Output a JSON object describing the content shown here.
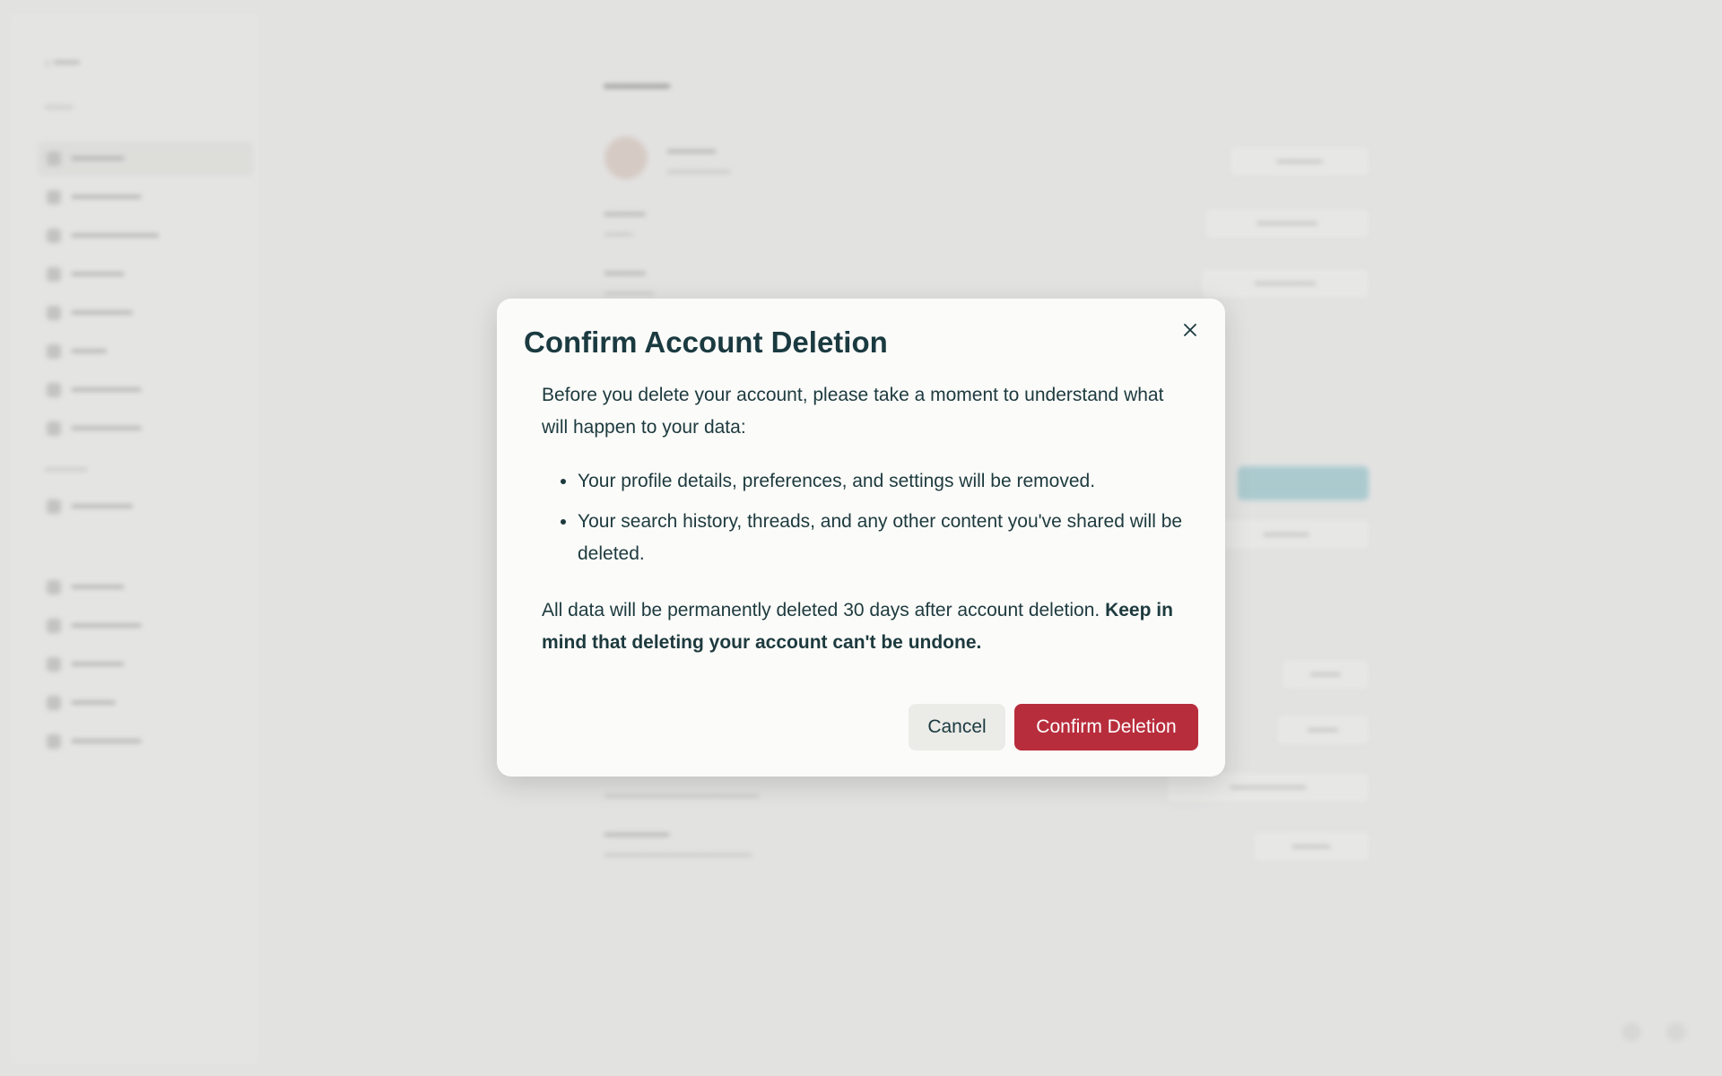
{
  "modal": {
    "title": "Confirm Account Deletion",
    "intro": "Before you delete your account, please take a moment to understand what will happen to your data:",
    "bullets": [
      "Your profile details, preferences, and settings will be removed.",
      "Your search history, threads, and any other content you've shared will be deleted."
    ],
    "warning_plain": "All data will be permanently deleted 30 days after account deletion.",
    "warning_bold": "Keep in mind that deleting your account can't be undone.",
    "cancel_label": "Cancel",
    "confirm_label": "Confirm Deletion",
    "close_icon": "close-icon"
  },
  "colors": {
    "confirm_button": "#b82d3c",
    "cancel_button": "#ebebe7",
    "text": "#1d3a3e",
    "overlay": "#e2e2e1"
  }
}
